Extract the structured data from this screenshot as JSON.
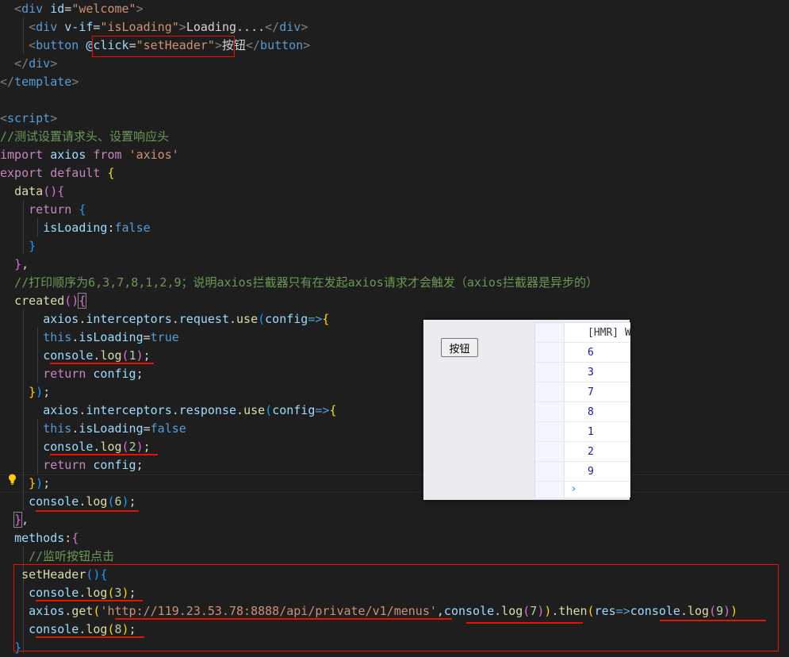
{
  "code": {
    "l1": {
      "attr": "id",
      "value": "\"welcome\""
    },
    "l2": {
      "attr": "v-if",
      "value": "\"isLoading\"",
      "text": "Loading...."
    },
    "l3": {
      "attr": "@click",
      "value": "\"setHeader\"",
      "text": "按钮"
    },
    "comment_test": "//测试设置请求头、设置响应头",
    "import_line": {
      "module": "axios",
      "source": "'axios'"
    },
    "comment_order": "//打印顺序为6,3,7,8,1,2,9；说明axios拦截器只有在发起axios请求才会触发（axios拦截器是异步的）",
    "comment_listen": "//监听按钮点击",
    "url": "'http://119.23.53.78:8888/api/private/v1/menus'"
  },
  "preview": {
    "button_label": "按钮",
    "hmr_text": "[HMR] W",
    "log_values": [
      "6",
      "3",
      "7",
      "8",
      "1",
      "2",
      "9"
    ],
    "prompt": "›"
  }
}
